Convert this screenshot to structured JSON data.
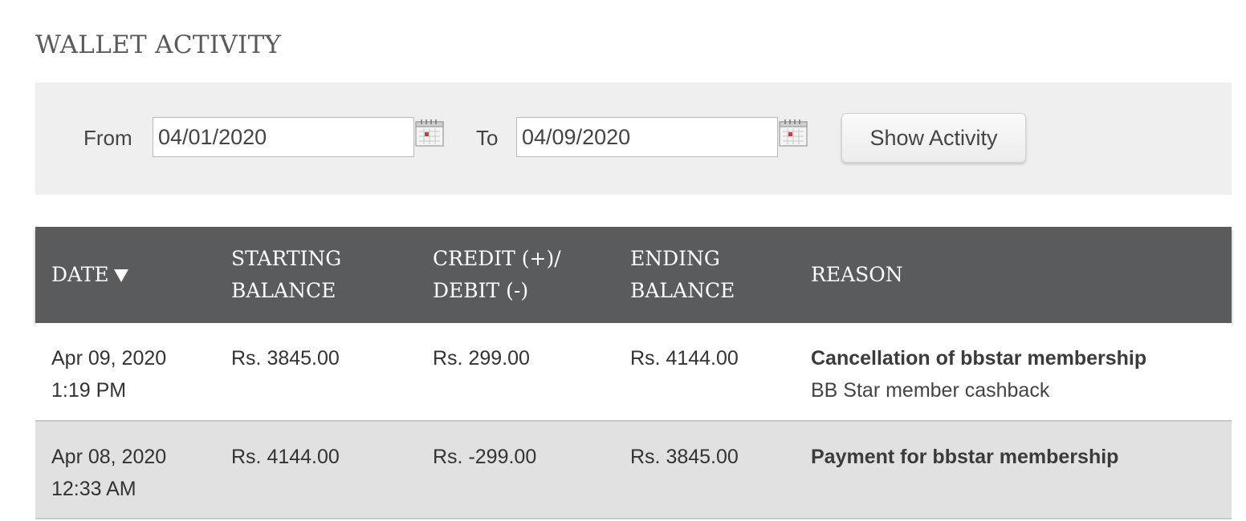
{
  "page": {
    "title": "WALLET ACTIVITY"
  },
  "filter": {
    "from_label": "From",
    "from_value": "04/01/2020",
    "to_label": "To",
    "to_value": "04/09/2020",
    "calendar_icon": "calendar-icon",
    "show_button_label": "Show Activity"
  },
  "table": {
    "sort_icon": "sort-down-icon",
    "headers": [
      {
        "line1": "DATE",
        "line2": ""
      },
      {
        "line1": "STARTING",
        "line2": "BALANCE"
      },
      {
        "line1": "CREDIT (+)/",
        "line2": "DEBIT (-)"
      },
      {
        "line1": "ENDING",
        "line2": "BALANCE"
      },
      {
        "line1": "REASON",
        "line2": ""
      }
    ],
    "rows": [
      {
        "date": "Apr 09, 2020",
        "time": "1:19 PM",
        "starting_balance": "Rs. 3845.00",
        "credit_debit": "Rs. 299.00",
        "ending_balance": "Rs. 4144.00",
        "reason_title": "Cancellation of bbstar membership",
        "reason_detail": "BB Star member cashback"
      },
      {
        "date": "Apr 08, 2020",
        "time": "12:33 AM",
        "starting_balance": "Rs. 4144.00",
        "credit_debit": "Rs. -299.00",
        "ending_balance": "Rs. 3845.00",
        "reason_title": "Payment for bbstar membership",
        "reason_detail": ""
      }
    ]
  },
  "colors": {
    "header_bg": "#5a5b5d",
    "filter_bg": "#efefef",
    "alt_row_bg": "#e1e1e1",
    "calendar_accent": "#d23a3a"
  }
}
